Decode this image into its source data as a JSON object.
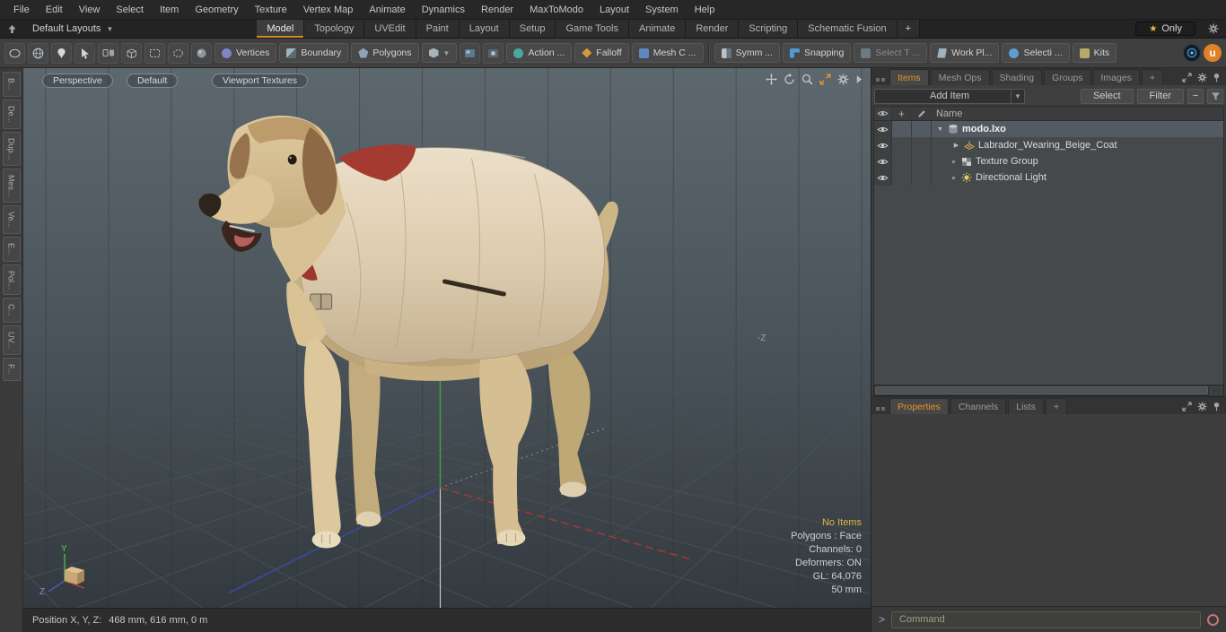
{
  "colors": {
    "accent": "#cf8a2d",
    "red_trim": "#a53a31",
    "coat": "#ddd0b6",
    "viewport_top": "#5d676e",
    "viewport_bottom": "#333a3f"
  },
  "menubar": {
    "items": [
      "File",
      "Edit",
      "View",
      "Select",
      "Item",
      "Geometry",
      "Texture",
      "Vertex Map",
      "Animate",
      "Dynamics",
      "Render",
      "MaxToModo",
      "Layout",
      "System",
      "Help"
    ]
  },
  "layoutbar": {
    "layouts_button": "Default Layouts",
    "tabs": [
      "Model",
      "Topology",
      "UVEdit",
      "Paint",
      "Layout",
      "Setup",
      "Game Tools",
      "Animate",
      "Render",
      "Scripting",
      "Schematic Fusion"
    ],
    "add_tab": "+",
    "only_button": "Only"
  },
  "toolbar": {
    "vertices": "Vertices",
    "boundary": "Boundary",
    "polygons": "Polygons",
    "action": "Action  ...",
    "falloff": "Falloff",
    "mesh_constraints": "Mesh C ...",
    "symmetry": "Symm ...",
    "snapping": "Snapping",
    "select_through": "Select T ...",
    "work_plane": "Work Pl...",
    "selection_sets": "Selecti ...",
    "kits": "Kits"
  },
  "left_tabs": [
    "B...",
    "De...",
    "Dup...",
    "Mes...",
    "Ve...",
    "E...",
    "Pol...",
    "C...",
    "UV...",
    "F..."
  ],
  "viewport": {
    "buttons": {
      "perspective": "Perspective",
      "default": "Default",
      "textures": "Viewport Textures"
    },
    "axis_label_negz": "-Z",
    "gizmo": {
      "y": "Y",
      "z": "Z"
    },
    "info": [
      "No Items",
      "Polygons : Face",
      "Channels: 0",
      "Deformers: ON",
      "GL: 64,076",
      "50 mm"
    ]
  },
  "statusbar": {
    "label": "Position X, Y, Z:",
    "value": "468 mm, 616 mm, 0 m"
  },
  "right_panel": {
    "items_tabs": [
      "Items",
      "Mesh Ops",
      "Shading",
      "Groups",
      "Images"
    ],
    "items_add_tab": "+",
    "add_item_button": "Add Item",
    "select_button": "Select",
    "filter_button": "Filter",
    "name_header": "Name",
    "tree": [
      {
        "label": "modo.lxo",
        "type": "scene"
      },
      {
        "label": "Labrador_Wearing_Beige_Coat",
        "type": "mesh"
      },
      {
        "label": "Texture Group",
        "type": "texture-group"
      },
      {
        "label": "Directional Light",
        "type": "light"
      }
    ],
    "props_tabs": [
      "Properties",
      "Channels",
      "Lists"
    ],
    "props_add_tab": "+",
    "command": {
      "prompt": ">",
      "placeholder": "Command"
    }
  }
}
